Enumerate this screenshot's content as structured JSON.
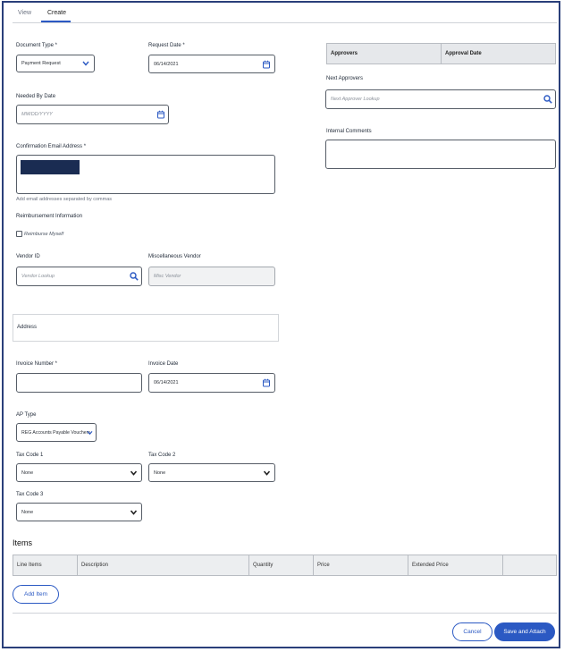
{
  "tabs": [
    {
      "label": "View",
      "active": false
    },
    {
      "label": "Create",
      "active": true
    }
  ],
  "form": {
    "document_type": {
      "label": "Document Type *",
      "value": "Payment Request"
    },
    "request_date": {
      "label": "Request Date *",
      "value": "06/14/2021"
    },
    "needed_by_date": {
      "label": "Needed By Date",
      "placeholder": "MM/DD/YYYY"
    },
    "confirmation_email": {
      "label": "Confirmation Email Address *",
      "hint": "Add email addresses separated by commas"
    },
    "reimbursement": {
      "label": "Reimbursement Information",
      "checkbox_label": "Reimburse Myself",
      "checked": false
    },
    "vendor_id": {
      "label": "Vendor ID",
      "placeholder": "Vendor Lookup"
    },
    "misc_vendor": {
      "label": "Miscellaneous Vendor",
      "placeholder": "Misc Vendor"
    },
    "address": {
      "label": "Address"
    },
    "invoice_number": {
      "label": "Invoice Number *",
      "value": ""
    },
    "invoice_date": {
      "label": "Invoice Date",
      "value": "06/14/2021"
    },
    "ap_type": {
      "label": "AP Type",
      "value": "REG Accounts Payable Vouchers"
    },
    "tax_code_1": {
      "label": "Tax Code 1",
      "value": "None"
    },
    "tax_code_2": {
      "label": "Tax Code 2",
      "value": "None"
    },
    "tax_code_3": {
      "label": "Tax Code 3",
      "value": "None"
    }
  },
  "approvals": {
    "headers": [
      "Approvers",
      "Approval Date"
    ],
    "next_approvers": {
      "label": "Next Approvers",
      "placeholder": "Next Approver Lookup"
    },
    "internal_comments": {
      "label": "Internal Comments"
    }
  },
  "items": {
    "title": "Items",
    "headers": [
      "Line Items",
      "Description",
      "Quantity",
      "Price",
      "Extended Price",
      ""
    ],
    "add_label": "Add Item"
  },
  "footer": {
    "cancel_label": "Cancel",
    "save_label": "Save and Attach"
  },
  "colors": {
    "accent": "#2b59c3",
    "frame_border": "#2a3f7a",
    "redacted": "#1a2c52"
  },
  "icons": {
    "dropdown": "chevron-down-icon",
    "date": "calendar-icon",
    "lookup": "search-icon"
  }
}
